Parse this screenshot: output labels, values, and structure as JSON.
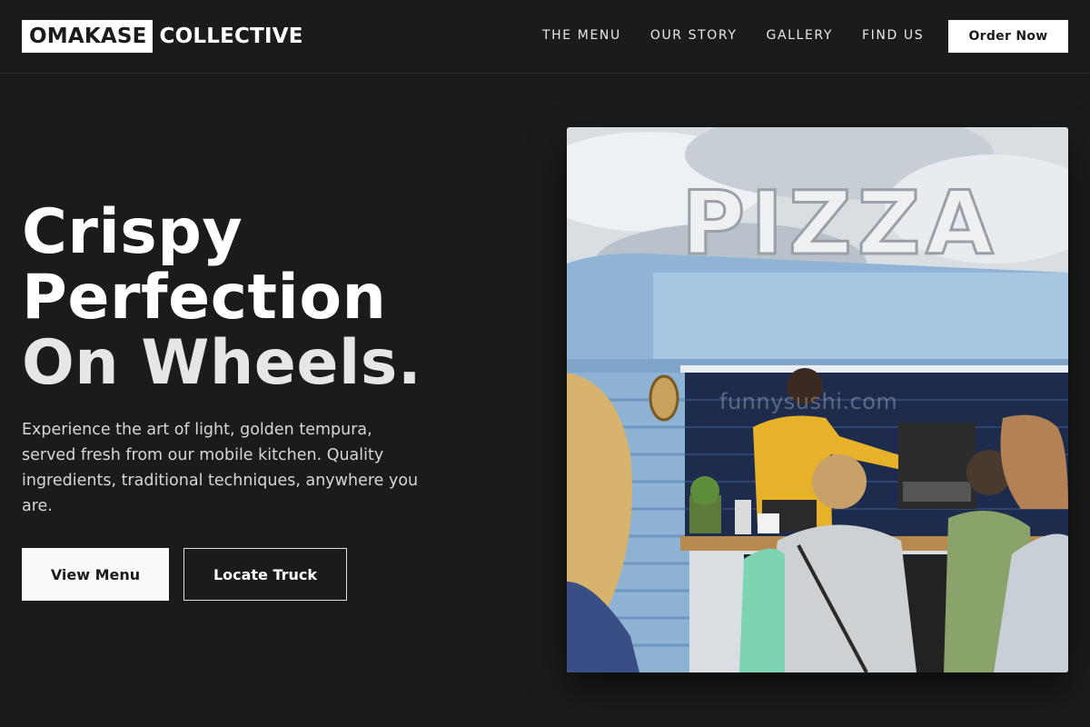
{
  "brand": {
    "logo_box": "OMAKASE",
    "logo_text": "COLLECTIVE"
  },
  "nav": {
    "links": [
      "THE MENU",
      "OUR STORY",
      "GALLERY",
      "FIND US"
    ],
    "cta": "Order Now"
  },
  "hero": {
    "headline_line1": "Crispy",
    "headline_line2": "Perfection",
    "headline_line3": "On Wheels.",
    "description": "Experience the art of light, golden tempura, served fresh from our mobile kitchen. Quality ingredients, traditional techniques, anywhere you are.",
    "primary_button": "View Menu",
    "secondary_button": "Locate Truck",
    "image_sign": "PIZZA",
    "image_watermark": "funnysushi.com"
  },
  "colors": {
    "background": "#1b1b1b",
    "text": "#ffffff",
    "button_light": "#f8f9fb",
    "truck_blue": "#8fb4d6"
  }
}
